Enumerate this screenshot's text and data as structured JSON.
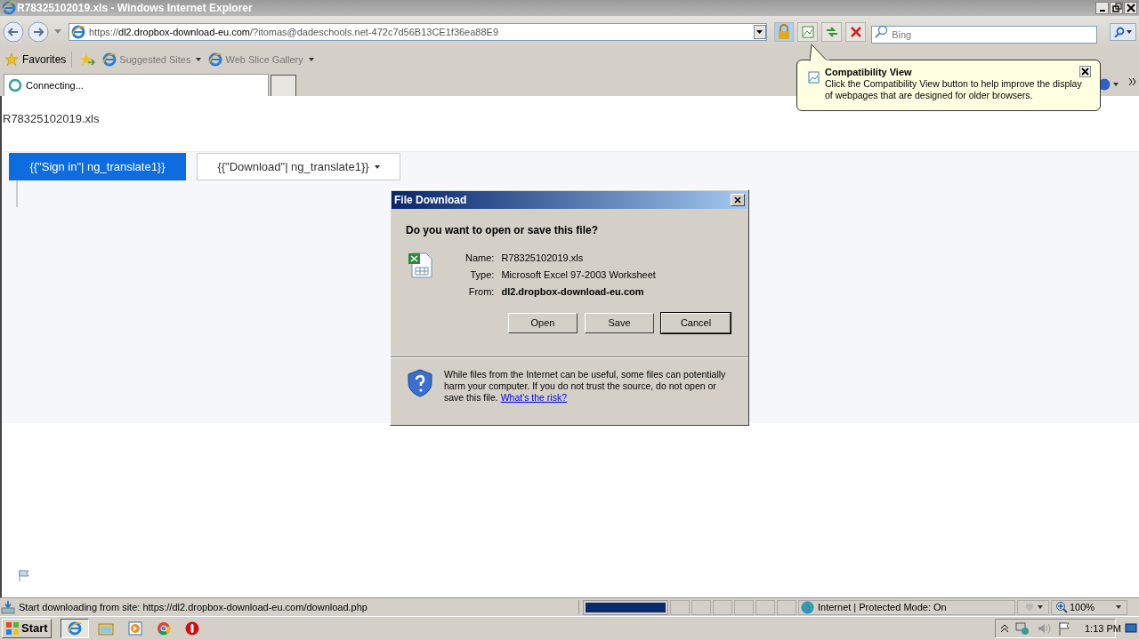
{
  "window": {
    "title": "R78325102019.xls - Windows Internet Explorer"
  },
  "address_bar": {
    "url_host_prefix": "https://",
    "url_host": "dl2.dropbox-download-eu.com",
    "url_rest": "/?itomas@dadeschools.net-472c7d56B13CE1f36ea88E9"
  },
  "search": {
    "placeholder": "Bing"
  },
  "favorites_bar": {
    "favorites": "Favorites",
    "items": [
      "Suggested Sites",
      "Web Slice Gallery"
    ]
  },
  "tabs": [
    {
      "label": "Connecting...",
      "selected": true
    }
  ],
  "tooltip": {
    "title": "Compatibility View",
    "text": "Click the Compatibility View button to help improve the display of webpages that are designed for older browsers."
  },
  "page": {
    "heading": "R78325102019.xls",
    "buttons": [
      {
        "label": "{{\"Sign in\"| ng_translate1}}",
        "kind": "primary"
      },
      {
        "label": "{{\"Download\"| ng_translate1}}",
        "kind": "dropdown"
      }
    ]
  },
  "dialog": {
    "title": "File Download",
    "question": "Do you want to open or save this file?",
    "fields": [
      {
        "label": "Name:",
        "value": "R78325102019.xls",
        "bold": false
      },
      {
        "label": "Type:",
        "value": "Microsoft Excel 97-2003 Worksheet",
        "bold": false
      },
      {
        "label": "From:",
        "value": "dl2.dropbox-download-eu.com",
        "bold": true
      }
    ],
    "buttons": [
      {
        "label": "Open",
        "default": false
      },
      {
        "label": "Save",
        "default": false
      },
      {
        "label": "Cancel",
        "default": true
      }
    ],
    "warning": "While files from the Internet can be useful, some files can potentially harm your computer. If you do not trust the source, do not open or save this file.",
    "risk_link": "What's the risk?"
  },
  "status_bar": {
    "text": "Start downloading from site: https://dl2.dropbox-download-eu.com/download.php",
    "progress": {
      "level": 1
    },
    "zone": "Internet | Protected Mode: On",
    "zoom": "100%"
  },
  "taskbar": {
    "start": "Start",
    "time": "1:13 PM"
  }
}
